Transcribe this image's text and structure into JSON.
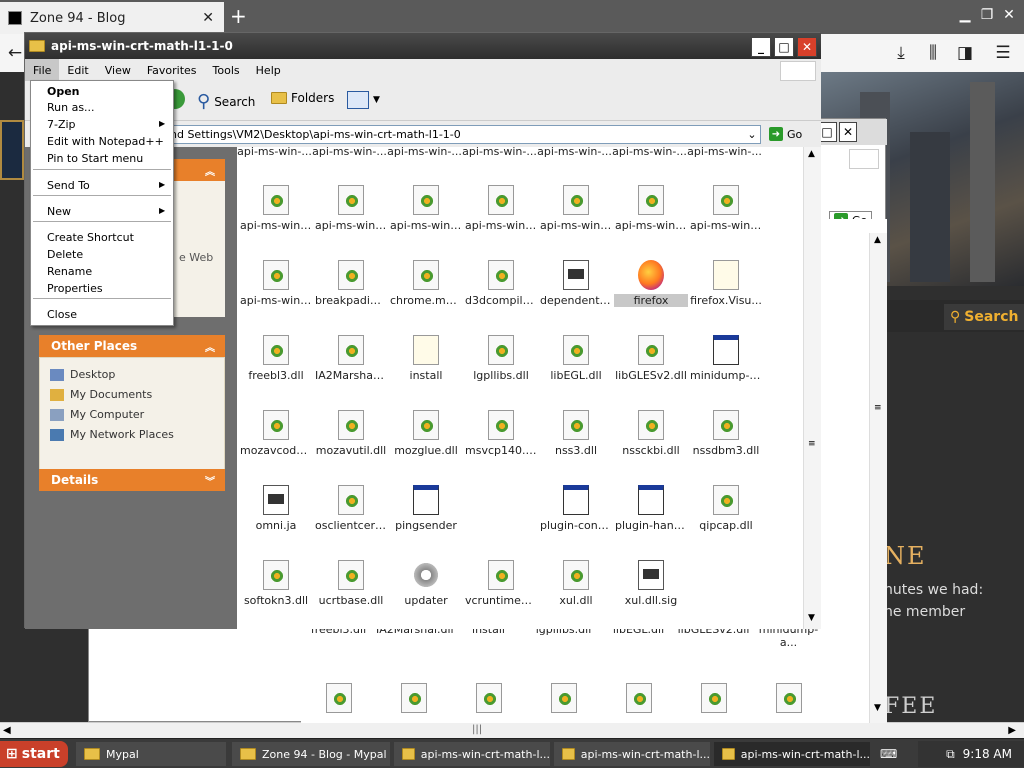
{
  "browser": {
    "tab_title": "Zone 94 - Blog",
    "search_text": "Search",
    "site": {
      "heading": "NE",
      "line1": "nutes we had:",
      "line2": "ne member",
      "line3": "FEE"
    }
  },
  "explorer": {
    "title": "api-ms-win-crt-math-l1-1-0",
    "menu": [
      "File",
      "Edit",
      "View",
      "Favorites",
      "Tools",
      "Help"
    ],
    "toolbar": {
      "search": "Search",
      "folders": "Folders"
    },
    "address": "nd Settings\\VM2\\Desktop\\api-ms-win-crt-math-l1-1-0",
    "go": "Go",
    "other_places_title": "Other Places",
    "places": [
      "Desktop",
      "My Documents",
      "My Computer",
      "My Network Places"
    ],
    "details_title": "Details",
    "web_fragment": "e Web",
    "files": [
      {
        "name": "api-ms-win-...",
        "type": "dll"
      },
      {
        "name": "api-ms-win-...",
        "type": "dll"
      },
      {
        "name": "api-ms-win-...",
        "type": "dll"
      },
      {
        "name": "api-ms-win-...",
        "type": "dll"
      },
      {
        "name": "api-ms-win-...",
        "type": "dll"
      },
      {
        "name": "api-ms-win-...",
        "type": "dll"
      },
      {
        "name": "api-ms-win-...",
        "type": "dll"
      },
      {
        "name": "api-ms-win-...",
        "type": "dll"
      },
      {
        "name": "breakpadinj...",
        "type": "dll"
      },
      {
        "name": "chrome.man...",
        "type": "dll"
      },
      {
        "name": "d3dcompiler...",
        "type": "dll"
      },
      {
        "name": "dependentli...",
        "type": "ja"
      },
      {
        "name": "firefox",
        "type": "ff",
        "selected": true
      },
      {
        "name": "firefox.Visu...",
        "type": "doc"
      },
      {
        "name": "freebl3.dll",
        "type": "dll"
      },
      {
        "name": "IA2Marshal.dll",
        "type": "dll"
      },
      {
        "name": "install",
        "type": "doc"
      },
      {
        "name": "lgpllibs.dll",
        "type": "dll"
      },
      {
        "name": "libEGL.dll",
        "type": "dll"
      },
      {
        "name": "libGLESv2.dll",
        "type": "dll"
      },
      {
        "name": "minidump-a...",
        "type": "exe"
      },
      {
        "name": "mozavcodec...",
        "type": "dll"
      },
      {
        "name": "mozavutil.dll",
        "type": "dll"
      },
      {
        "name": "mozglue.dll",
        "type": "dll"
      },
      {
        "name": "msvcp140.dll",
        "type": "dll"
      },
      {
        "name": "nss3.dll",
        "type": "dll"
      },
      {
        "name": "nssckbi.dll",
        "type": "dll"
      },
      {
        "name": "nssdbm3.dll",
        "type": "dll"
      },
      {
        "name": "omni.ja",
        "type": "ja"
      },
      {
        "name": "osclientcert...",
        "type": "dll"
      },
      {
        "name": "pingsender",
        "type": "exe"
      },
      {
        "name": "",
        "type": "none"
      },
      {
        "name": "plugin-cont...",
        "type": "exe"
      },
      {
        "name": "plugin-hang-ui",
        "type": "exe"
      },
      {
        "name": "qipcap.dll",
        "type": "dll"
      },
      {
        "name": "softokn3.dll",
        "type": "dll"
      },
      {
        "name": "ucrtbase.dll",
        "type": "dll"
      },
      {
        "name": "updater",
        "type": "upd"
      },
      {
        "name": "vcruntime1...",
        "type": "dll"
      },
      {
        "name": "xul.dll",
        "type": "dll"
      },
      {
        "name": "xul.dll.sig",
        "type": "ja"
      }
    ],
    "back_labels": [
      "freebl3.dll",
      "IA2Marshal.dll",
      "install",
      "lgpllibs.dll",
      "libEGL.dll",
      "libGLESv2.dll",
      "minidump-a..."
    ]
  },
  "context_menu": {
    "items": [
      "Open",
      "Run as...",
      "7-Zip",
      "Edit with Notepad++",
      "Pin to Start menu",
      "Send To",
      "New",
      "Create Shortcut",
      "Delete",
      "Rename",
      "Properties",
      "Close"
    ]
  },
  "taskbar": {
    "start": "start",
    "tasks": [
      "Mypal",
      "Zone 94 - Blog - Mypal",
      "api-ms-win-crt-math-l...",
      "api-ms-win-crt-math-l...",
      "api-ms-win-crt-math-l..."
    ],
    "clock": "9:18 AM"
  }
}
